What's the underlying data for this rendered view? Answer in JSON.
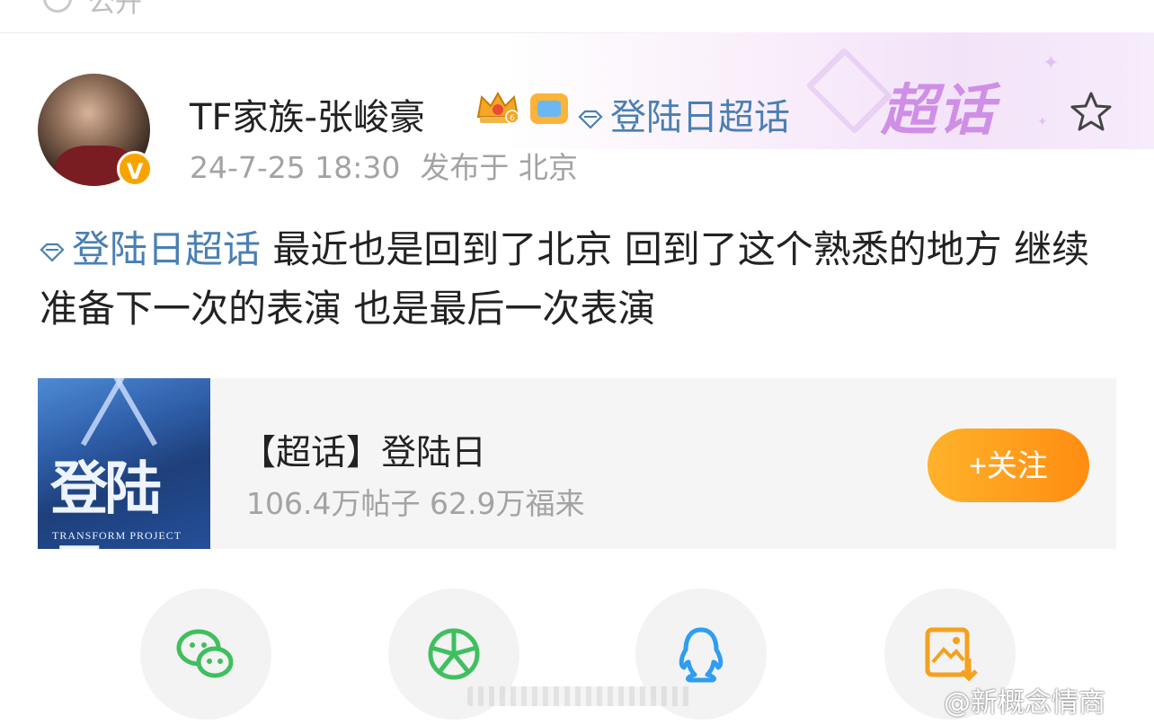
{
  "top_bar": {
    "label": "公开"
  },
  "banner": {
    "label": "超话"
  },
  "post": {
    "author": "TF家族-张峻豪",
    "header_topic": "登陆日超话",
    "timestamp": "24-7-25 18:30",
    "location": "发布于 北京",
    "content_topic": "登陆日超话",
    "content_text": " 最近也是回到了北京 回到了这个熟悉的地方 继续准备下一次的表演 也是最后一次表演"
  },
  "supertopic_card": {
    "thumb_title": "登陆日",
    "thumb_subtitle": "TRANSFORM PROJECT",
    "title": "【超话】登陆日",
    "stats": "106.4万帖子 62.9万福来",
    "follow_label": "+关注"
  },
  "share_icons": [
    "wechat-icon",
    "moments-icon",
    "qq-icon",
    "save-image-icon"
  ],
  "watermark": "@新概念情商",
  "colors": {
    "link": "#4a7fb3",
    "follow": "#ff9a1c",
    "chaohua": "#cf8fe6"
  }
}
